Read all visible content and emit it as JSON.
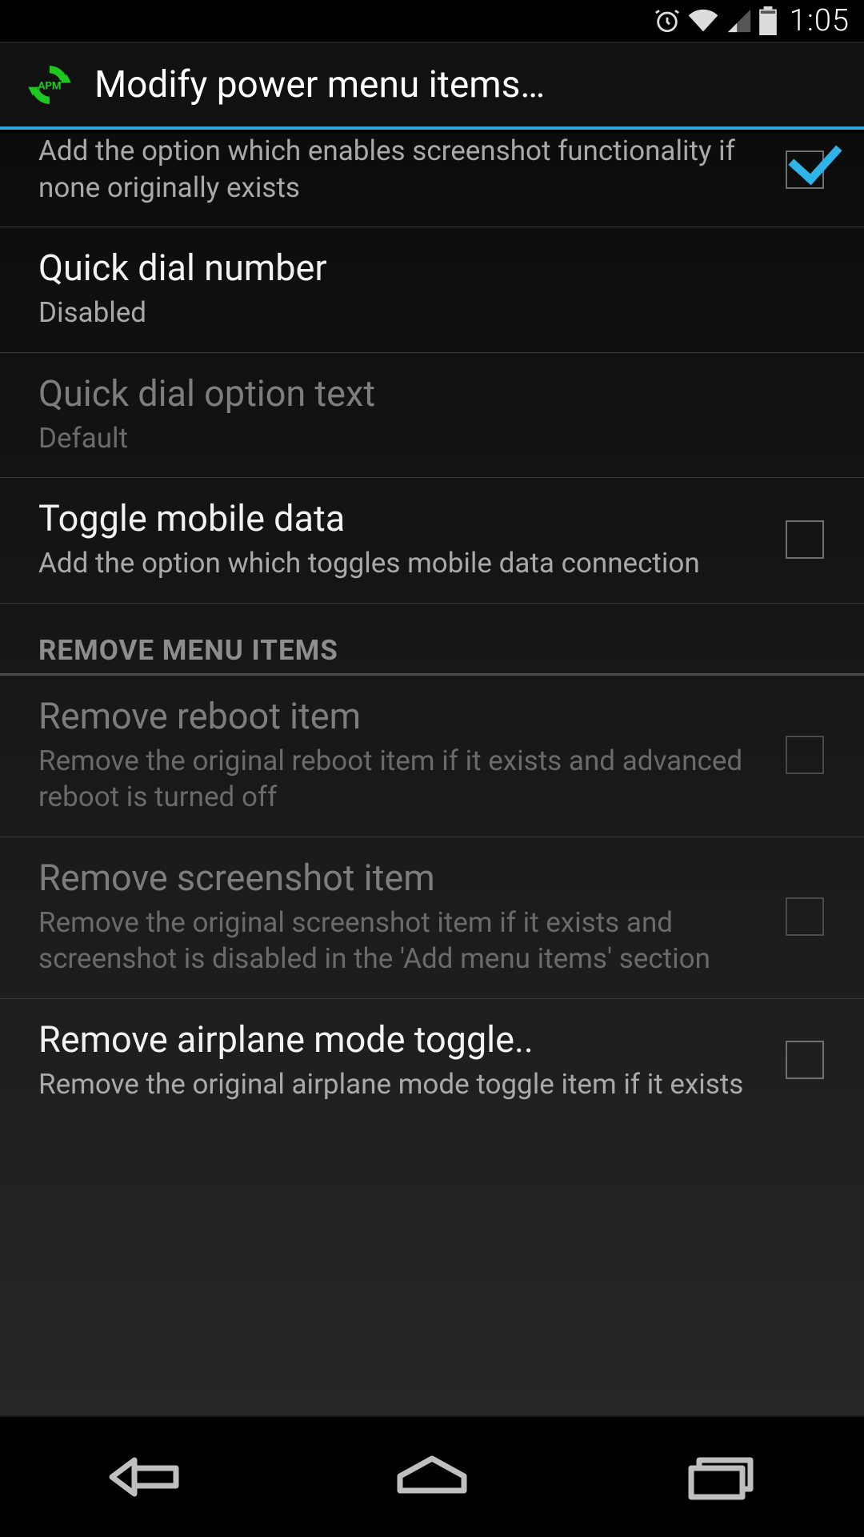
{
  "status": {
    "time": "1:05"
  },
  "header": {
    "title": "Modify power menu items…"
  },
  "prefs": {
    "screenshot": {
      "summary": "Add the option which enables screenshot functionality if none originally exists",
      "checked": true
    },
    "quick_dial_number": {
      "title": "Quick dial number",
      "summary": "Disabled"
    },
    "quick_dial_text": {
      "title": "Quick dial option text",
      "summary": "Default"
    },
    "toggle_mobile_data": {
      "title": "Toggle mobile data",
      "summary": "Add the option which toggles mobile data connection",
      "checked": false
    }
  },
  "sections": {
    "remove_items": {
      "header": "REMOVE MENU ITEMS",
      "remove_reboot": {
        "title": "Remove reboot item",
        "summary": "Remove the original reboot item if it exists and advanced reboot is turned off",
        "checked": false
      },
      "remove_screenshot": {
        "title": "Remove screenshot item",
        "summary": "Remove the original screenshot item if it exists and screenshot is disabled in the 'Add menu items' section",
        "checked": false
      },
      "remove_airplane": {
        "title": "Remove airplane mode toggle..",
        "summary": "Remove the original airplane mode toggle item if it exists",
        "checked": false
      }
    }
  }
}
